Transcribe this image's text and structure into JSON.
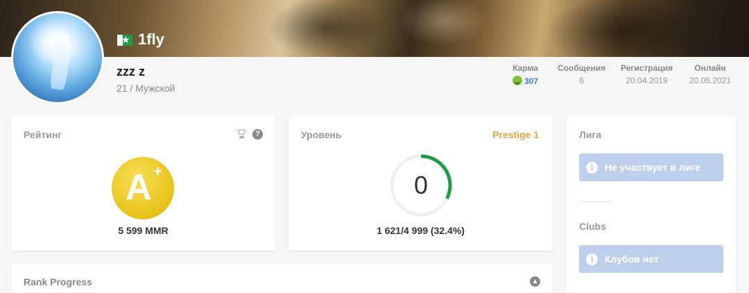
{
  "profile": {
    "nickname": "1fly",
    "real_name": "zzz z",
    "age_sex": "21 / Мужской",
    "flag_icon": "country-flag-icon"
  },
  "stats": [
    {
      "label": "Карма",
      "value": "307"
    },
    {
      "label": "Сообщения",
      "value": "6"
    },
    {
      "label": "Регистрация",
      "value": "20.04.2019"
    },
    {
      "label": "Онлайн",
      "value": "20.05.2021"
    }
  ],
  "rating": {
    "title": "Рейтинг",
    "rank": "A",
    "rank_modifier": "+",
    "mmr": "5 599 MMR",
    "badge_color": "#e8c21a"
  },
  "level": {
    "title": "Уровень",
    "prestige": "Prestige 1",
    "value": "0",
    "xp": "1 621/4 999 (32.4%)",
    "progress_fraction": 0.324,
    "progress_color": "#1f9d45"
  },
  "league": {
    "title": "Лига",
    "notice": "Не участвует в лиге"
  },
  "clubs": {
    "title": "Clubs",
    "notice": "Клубов нет"
  },
  "rank_progress": {
    "title": "Rank Progress"
  }
}
